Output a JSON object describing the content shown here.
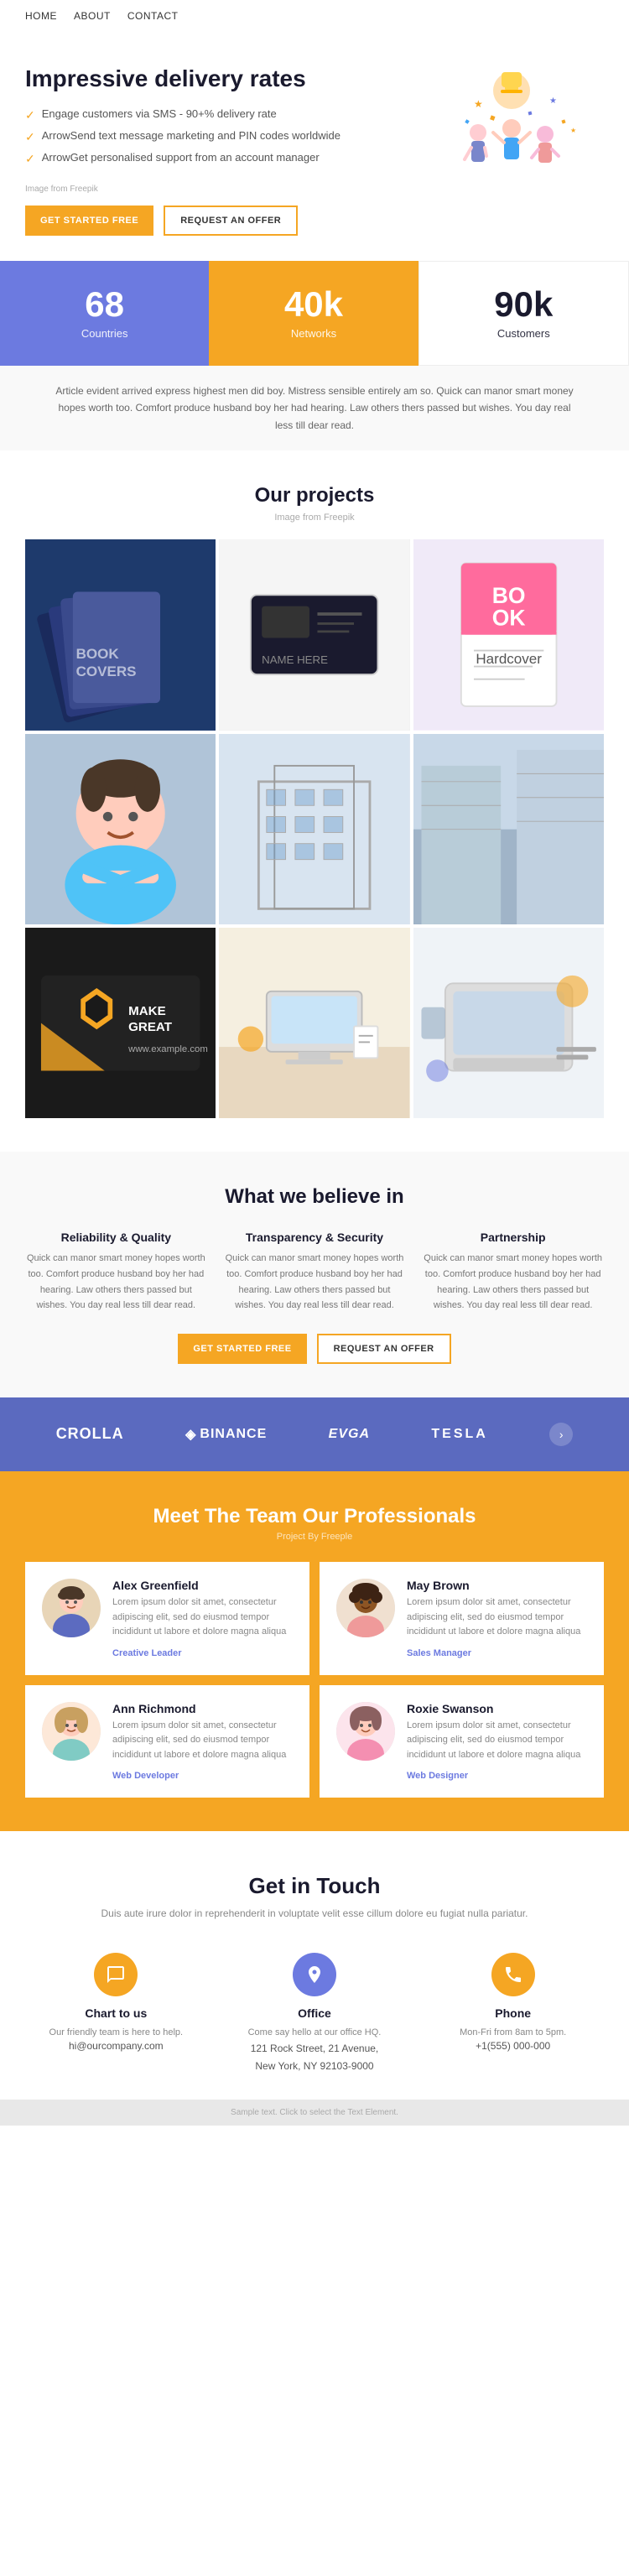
{
  "nav": {
    "links": [
      "Home",
      "About",
      "Contact"
    ]
  },
  "hero": {
    "title": "Impressive delivery rates",
    "features": [
      "Engage customers via SMS - 90+% delivery rate",
      "ArrowSend text message marketing and PIN codes worldwide",
      "ArrowGet personalised support from an account manager"
    ],
    "image_note": "Image from Freepik",
    "btn_start": "GET STARTED FREE",
    "btn_offer": "REQUEST AN OFFER"
  },
  "stats": [
    {
      "number": "68",
      "label": "Countries",
      "style": "blue"
    },
    {
      "number": "40k",
      "label": "Networks",
      "style": "orange"
    },
    {
      "number": "90k",
      "label": "Customers",
      "style": "white"
    }
  ],
  "stat_text": "Article evident arrived express highest men did boy. Mistress sensible entirely am so. Quick can manor smart money hopes worth too. Comfort produce husband boy her had hearing. Law others thers passed but wishes. You day real less till dear read.",
  "projects": {
    "title": "Our projects",
    "image_note": "Image from Freepik",
    "items": [
      "proj-1",
      "proj-2",
      "proj-3",
      "proj-4",
      "proj-5",
      "proj-6",
      "proj-7",
      "proj-8",
      "proj-9"
    ]
  },
  "beliefs": {
    "title": "What we believe in",
    "items": [
      {
        "title": "Reliability & Quality",
        "text": "Quick can manor smart money hopes worth too. Comfort produce husband boy her had hearing. Law others thers passed but wishes. You day real less till dear read."
      },
      {
        "title": "Transparency & Security",
        "text": "Quick can manor smart money hopes worth too. Comfort produce husband boy her had hearing. Law others thers passed but wishes. You day real less till dear read."
      },
      {
        "title": "Partnership",
        "text": "Quick can manor smart money hopes worth too. Comfort produce husband boy her had hearing. Law others thers passed but wishes. You day real less till dear read."
      }
    ],
    "btn_start": "GET STARTED FREE",
    "btn_offer": "REQUEST AN OFFER"
  },
  "brands": {
    "items": [
      "CROLLA",
      "◈ BINANCE",
      "EVGA",
      "TESLA"
    ]
  },
  "team": {
    "title": "Meet The Team Our Professionals",
    "subtitle": "Project By Freeple",
    "members": [
      {
        "name": "Alex Greenfield",
        "role": "Creative Leader",
        "text": "Lorem ipsum dolor sit amet, consectetur adipiscing elit, sed do eiusmod tempor incididunt ut labore et dolore magna aliqua"
      },
      {
        "name": "May Brown",
        "role": "Sales Manager",
        "text": "Lorem ipsum dolor sit amet, consectetur adipiscing elit, sed do eiusmod tempor incididunt ut labore et dolore magna aliqua"
      },
      {
        "name": "Ann Richmond",
        "role": "Web Developer",
        "text": "Lorem ipsum dolor sit amet, consectetur adipiscing elit, sed do eiusmod tempor incididunt ut labore et dolore magna aliqua"
      },
      {
        "name": "Roxie Swanson",
        "role": "Web Designer",
        "text": "Lorem ipsum dolor sit amet, consectetur adipiscing elit, sed do eiusmod tempor incididunt ut labore et dolore magna aliqua"
      }
    ]
  },
  "contact": {
    "title": "Get in Touch",
    "subtitle": "Duis aute irure dolor in reprehenderit in voluptate velit esse cillum dolore eu fugiat nulla pariatur.",
    "items": [
      {
        "icon": "💬",
        "icon_type": "orange",
        "title": "Chart to us",
        "text": "Our friendly team is here to help.",
        "detail": "hi@ourcompany.com"
      },
      {
        "icon": "📍",
        "icon_type": "blue",
        "title": "Office",
        "text": "Come say hello at our office HQ.",
        "detail": "121 Rock Street, 21 Avenue,\nNew York, NY 92103-9000"
      },
      {
        "icon": "📞",
        "icon_type": "orange",
        "title": "Phone",
        "text": "Mon-Fri from 8am to 5pm.",
        "detail": "+1(555) 000-000"
      }
    ]
  },
  "footer": {
    "note": "Sample text. Click to select the Text Element."
  }
}
